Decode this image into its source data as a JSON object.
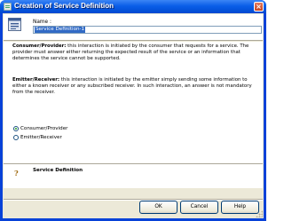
{
  "window": {
    "title": "Creation of Service Definition",
    "close_glyph": "×"
  },
  "header": {
    "icon": "service-definition-icon",
    "name_label": "Name :",
    "name_value": "Service Definition-1"
  },
  "descriptions": {
    "consumer_provider_heading": "Consumer/Provider:",
    "consumer_provider_text": " this interaction is initiated by the consumer that requests for a service. The provider must answer either returning the expected result of the service or an information that determines the service cannot be supported.",
    "emitter_receiver_heading": "Emitter/Receiver:",
    "emitter_receiver_text": " this interaction is initiated by the emitter simply sending some information to either a known receiver or any subscribed receiver. In such interaction, an answer is not mandatory from the receiver."
  },
  "options": [
    {
      "label": "Consumer/Provider",
      "selected": true
    },
    {
      "label": "Emitter/Receiver",
      "selected": false
    }
  ],
  "help_section": {
    "icon": "help-icon",
    "glyph": "?",
    "title": "Service Definition"
  },
  "buttons": {
    "ok": "OK",
    "cancel": "Cancel",
    "help": "Help"
  },
  "colors": {
    "titlebar": "#0a5ee8",
    "selection": "#316ac5",
    "dialog_bg": "#ece9d8"
  }
}
